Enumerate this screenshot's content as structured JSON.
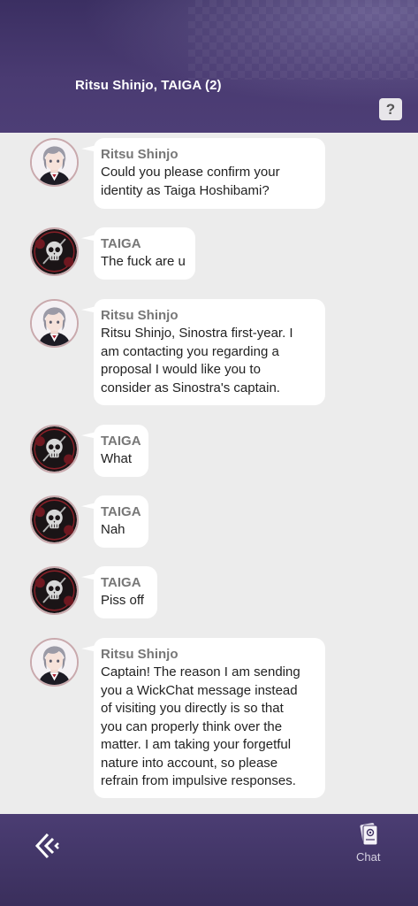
{
  "header": {
    "title": "Ritsu Shinjo, TAIGA (2)",
    "help_label": "?"
  },
  "messages": [
    {
      "sender": "Ritsu Shinjo",
      "avatar": "ritsu-avatar",
      "text": "Could you please confirm your\nidentity as Taiga Hoshibami?"
    },
    {
      "sender": "TAIGA",
      "avatar": "taiga-skull-avatar",
      "text": "The fuck are u"
    },
    {
      "sender": "Ritsu Shinjo",
      "avatar": "ritsu-avatar",
      "text": "Ritsu Shinjo, Sinostra first-year. I\nam contacting you regarding a\nproposal I would like you to\nconsider as Sinostra's captain."
    },
    {
      "sender": "TAIGA",
      "avatar": "taiga-skull-avatar",
      "text": "What"
    },
    {
      "sender": "TAIGA",
      "avatar": "taiga-skull-avatar",
      "text": "Nah"
    },
    {
      "sender": "TAIGA",
      "avatar": "taiga-skull-avatar",
      "text": "Piss off"
    },
    {
      "sender": "Ritsu Shinjo",
      "avatar": "ritsu-avatar",
      "text": "Captain! The reason I am sending\nyou a WickChat message instead\nof visiting you directly is so that\nyou can properly think over the\nmatter. I am taking your forgetful\nnature into account, so please\nrefrain from impulsive responses."
    }
  ],
  "footer": {
    "back_icon": "back-arrow-icon",
    "chat_icon": "chat-cards-icon",
    "chat_label": "Chat"
  },
  "colors": {
    "header_bg": "#4a3b72",
    "footer_bg": "#3f3264",
    "chat_bg": "#ececec",
    "bubble_bg": "#ffffff",
    "sender_text": "#777777",
    "avatar_ring": "#c9a9ad"
  }
}
